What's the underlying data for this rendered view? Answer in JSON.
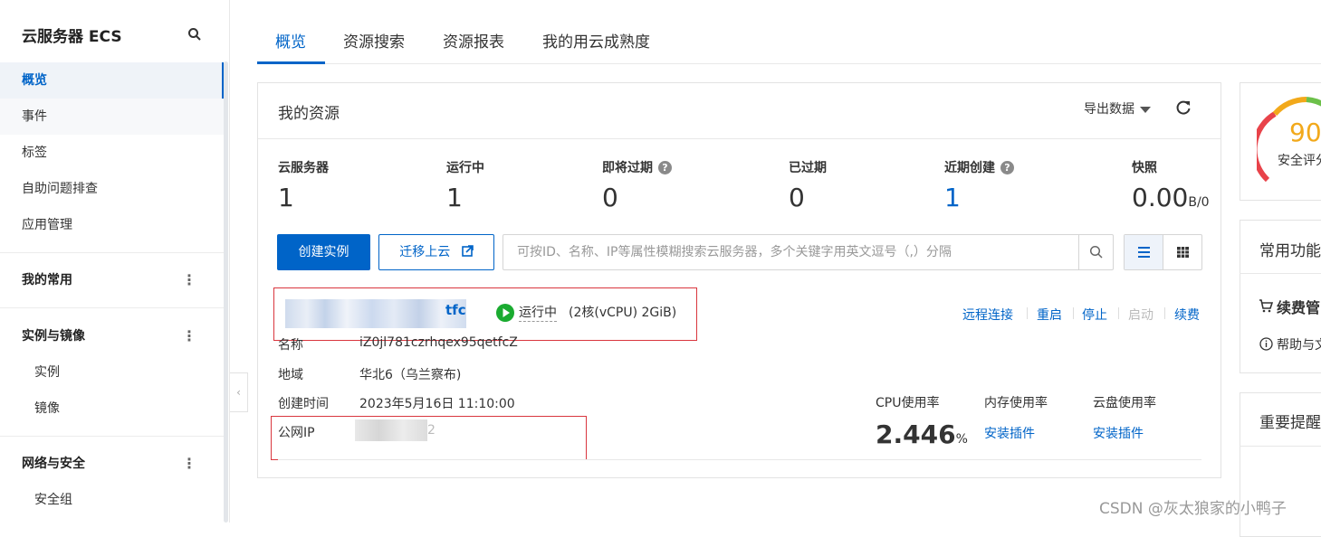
{
  "sidebar": {
    "title": "云服务器 ECS",
    "items": [
      {
        "label": "概览"
      },
      {
        "label": "事件"
      },
      {
        "label": "标签"
      },
      {
        "label": "自助问题排查"
      },
      {
        "label": "应用管理"
      }
    ],
    "sections": [
      {
        "label": "我的常用",
        "children": []
      },
      {
        "label": "实例与镜像",
        "children": [
          {
            "label": "实例"
          },
          {
            "label": "镜像"
          }
        ]
      },
      {
        "label": "网络与安全",
        "children": [
          {
            "label": "安全组"
          }
        ]
      }
    ],
    "collapse_glyph": "‹"
  },
  "tabs": [
    {
      "label": "概览",
      "active": true
    },
    {
      "label": "资源搜索"
    },
    {
      "label": "资源报表"
    },
    {
      "label": "我的用云成熟度"
    }
  ],
  "resources": {
    "title": "我的资源",
    "export_label": "导出数据",
    "stats": [
      {
        "label": "云服务器",
        "value": "1"
      },
      {
        "label": "运行中",
        "value": "1"
      },
      {
        "label": "即将过期",
        "value": "0",
        "help": "?"
      },
      {
        "label": "已过期",
        "value": "0"
      },
      {
        "label": "近期创建",
        "value": "1",
        "help": "?"
      },
      {
        "label": "快照",
        "value": "0.00",
        "unit": "B/0"
      }
    ],
    "create_button": "创建实例",
    "migrate_button": "迁移上云",
    "search_placeholder": "可按ID、名称、IP等属性模糊搜索云服务器，多个关键字用英文逗号（,）分隔",
    "instance": {
      "name_visible_tail": "tfc",
      "status": "运行中",
      "spec": "(2核(vCPU) 2GiB)",
      "actions": [
        "远程连接",
        "重启",
        "停止",
        "启动",
        "续费"
      ],
      "fields": [
        {
          "label": "名称",
          "value": "iZ0jl781czrhqex95qetfcZ"
        },
        {
          "label": "地域",
          "value": "华北6（乌兰察布)"
        },
        {
          "label": "创建时间",
          "value": "2023年5月16日 11:10:00"
        },
        {
          "label": "公网IP",
          "value": "2"
        }
      ],
      "metrics": {
        "cpu_label": "CPU使用率",
        "cpu_value": "2.446",
        "cpu_unit": "%",
        "mem_label": "内存使用率",
        "mem_link": "安装插件",
        "disk_label": "云盘使用率",
        "disk_link": "安装插件"
      }
    }
  },
  "right_panel": {
    "score": "90",
    "score_label": "安全评分",
    "common_title": "常用功能",
    "renew_label": "续费管",
    "help_label": "帮助与文",
    "important_title": "重要提醒"
  },
  "watermark": "CSDN @灰太狼家的小鸭子",
  "colors": {
    "accent": "#0064c8",
    "running": "#1aab30",
    "score": "#f2a91b",
    "highlight_box": "#d9363e"
  }
}
